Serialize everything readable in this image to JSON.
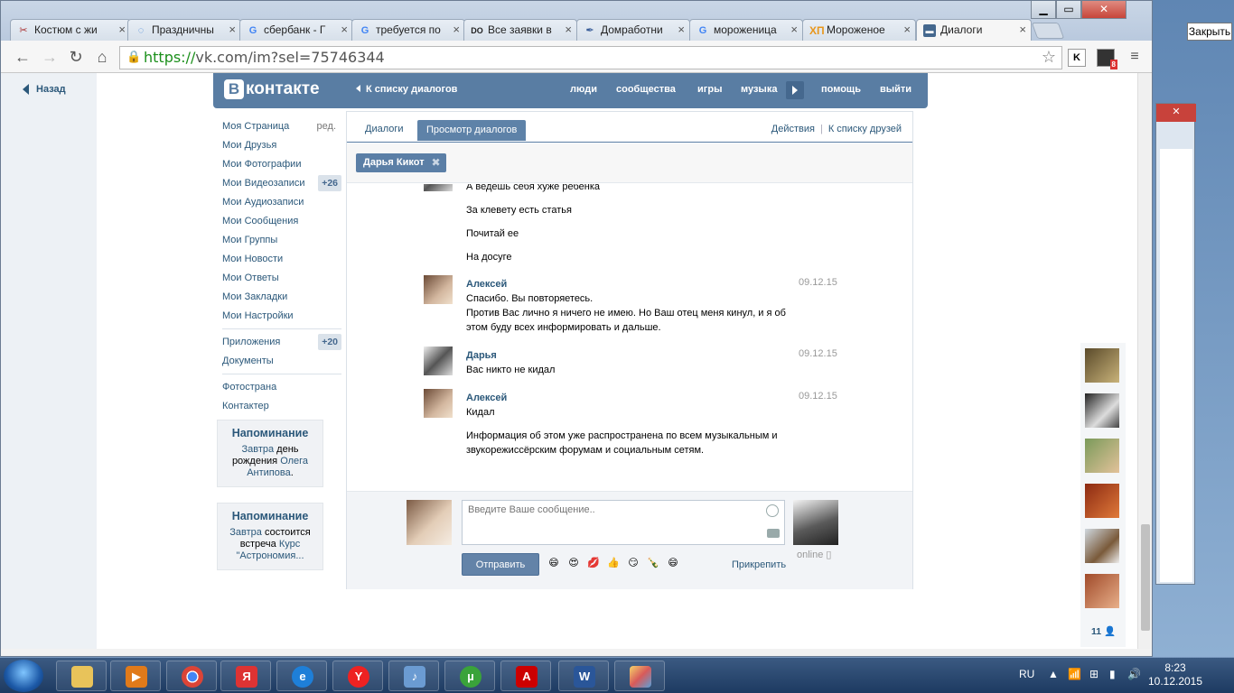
{
  "browser": {
    "tabs": [
      {
        "label": "Костюм с жи",
        "favicon": "scissors-icon"
      },
      {
        "label": "Праздничны",
        "favicon": "loading-spinner-icon"
      },
      {
        "label": "сбербанк - Г",
        "favicon": "google-icon"
      },
      {
        "label": "требуется по",
        "favicon": "google-icon"
      },
      {
        "label": "Все заявки в",
        "favicon": "do-icon"
      },
      {
        "label": "Домработни",
        "favicon": "pen-icon"
      },
      {
        "label": "мороженица",
        "favicon": "google-icon"
      },
      {
        "label": "Мороженое",
        "favicon": "xp-icon"
      },
      {
        "label": "Диалоги",
        "favicon": "vk-dialog-icon"
      }
    ],
    "url_scheme": "https://",
    "url_rest": "vk.com/im?sel=75746344",
    "close_tooltip": "Закрыть",
    "ext_k": "K",
    "ext_badge": "8"
  },
  "page": {
    "back": "Назад",
    "vk_logo_b": "В",
    "vk_logo_text": "контакте",
    "back_to_list": "К списку диалогов",
    "topnav": [
      "люди",
      "сообщества",
      "игры",
      "музыка",
      "помощь",
      "выйти"
    ],
    "menu": [
      {
        "label": "Моя Страница",
        "extra": "ред."
      },
      {
        "label": "Мои Друзья"
      },
      {
        "label": "Мои Фотографии"
      },
      {
        "label": "Мои Видеозаписи",
        "badge": "+26"
      },
      {
        "label": "Мои Аудиозаписи"
      },
      {
        "label": "Мои Сообщения"
      },
      {
        "label": "Мои Группы"
      },
      {
        "label": "Мои Новости"
      },
      {
        "label": "Мои Ответы"
      },
      {
        "label": "Мои Закладки"
      },
      {
        "label": "Мои Настройки"
      }
    ],
    "menu2": [
      {
        "label": "Приложения",
        "badge": "+20"
      },
      {
        "label": "Документы"
      }
    ],
    "menu3": [
      {
        "label": "Фотострана"
      },
      {
        "label": "Контактер"
      }
    ],
    "reminders": [
      {
        "title": "Напоминание",
        "link1": "Завтра",
        "text1": " день рождения ",
        "link2": "Олега Антипова",
        "text2": "."
      },
      {
        "title": "Напоминание",
        "link1": "Завтра",
        "text1": " состоится встреча ",
        "link2": "Курс \"Астрономия...",
        "text2": ""
      }
    ],
    "tabs": {
      "dialogs": "Диалоги",
      "view": "Просмотр диалогов",
      "actions": "Действия",
      "separator": "|",
      "friends": "К списку друзей"
    },
    "peer_chip": "Дарья Кикот",
    "messages": [
      {
        "text": "А ведешь себя хуже ребенка"
      },
      {
        "text": "За клевету есть статья"
      },
      {
        "text": "Почитай ее"
      },
      {
        "text": "На досуге"
      },
      {
        "author": "Алексей",
        "date": "09.12.15",
        "lines": [
          "Спасибо. Вы повторяетесь.",
          "Против Вас лично я ничего не имею. Но Ваш отец меня кинул, и я об этом буду всех информировать и дальше."
        ]
      },
      {
        "author": "Дарья",
        "date": "09.12.15",
        "lines": [
          "Вас никто не кидал"
        ]
      },
      {
        "author": "Алексей",
        "date": "09.12.15",
        "lines": [
          "Кидал"
        ],
        "extra": "Информация об этом уже распространена по всем музыкальным и звукорежиссёрским форумам и социальным сетям."
      }
    ],
    "composer": {
      "placeholder": "Введите Ваше сообщение..",
      "send": "Отправить",
      "attach": "Прикрепить",
      "online": "online"
    },
    "emoji": [
      "😄",
      "😍",
      "💋",
      "👍",
      "😏",
      "🍾",
      "😄"
    ],
    "friends_count": "11"
  },
  "taskbar": {
    "items": [
      "folder-icon",
      "media-icon",
      "chrome-icon",
      "yandex-browser-icon",
      "ie-icon",
      "yandex-icon",
      "audio-icon",
      "utorrent-icon",
      "acrobat-icon",
      "word-icon",
      "paint-icon"
    ],
    "lang": "RU",
    "time": "8:23",
    "date": "10.12.2015"
  },
  "colors": {
    "vk_blue": "#597da3",
    "link": "#2b587a"
  }
}
